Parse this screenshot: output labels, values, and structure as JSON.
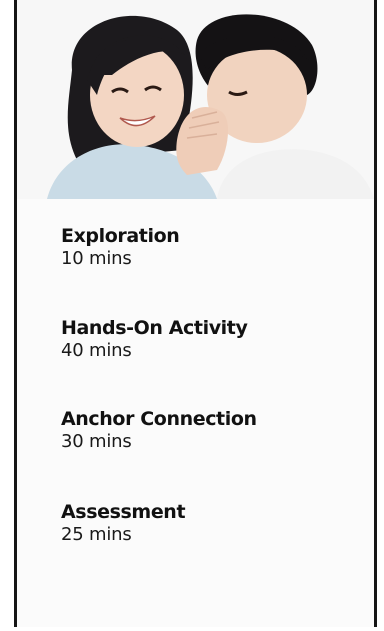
{
  "hero": {
    "image": "two-children-whispering-photo"
  },
  "activities": [
    {
      "title": "Exploration",
      "duration": "10 mins"
    },
    {
      "title": "Hands-On Activity",
      "duration": "40 mins"
    },
    {
      "title": "Anchor Connection",
      "duration": "30 mins"
    },
    {
      "title": "Assessment",
      "duration": "25 mins"
    }
  ],
  "colors": {
    "border": "#151515",
    "text": "#111111",
    "background": "#fbfbfb"
  }
}
